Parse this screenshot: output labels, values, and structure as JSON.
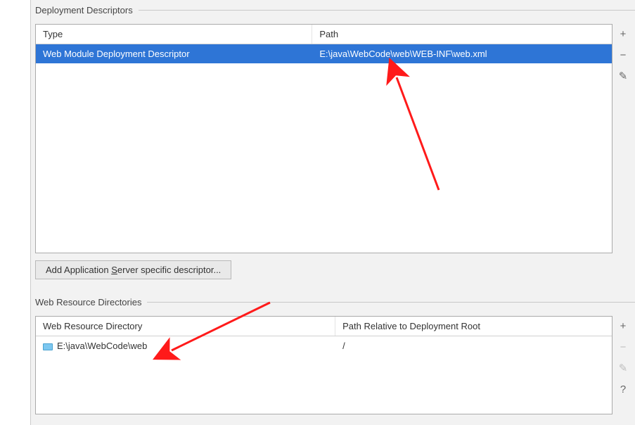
{
  "deployment_descriptors": {
    "title": "Deployment Descriptors",
    "columns": {
      "type": "Type",
      "path": "Path"
    },
    "rows": [
      {
        "type": "Web Module Deployment Descriptor",
        "path": "E:\\java\\WebCode\\web\\WEB-INF\\web.xml",
        "selected": true
      }
    ],
    "add_button": {
      "prefix": "Add Application ",
      "hotkey": "S",
      "suffix": "erver specific descriptor..."
    }
  },
  "web_resource_directories": {
    "title": "Web Resource Directories",
    "columns": {
      "dir": "Web Resource Directory",
      "rel": "Path Relative to Deployment Root"
    },
    "rows": [
      {
        "dir": "E:\\java\\WebCode\\web",
        "rel": "/",
        "selected": false
      }
    ]
  },
  "icons": {
    "plus": "+",
    "minus": "−",
    "edit": "✎",
    "help": "?"
  }
}
